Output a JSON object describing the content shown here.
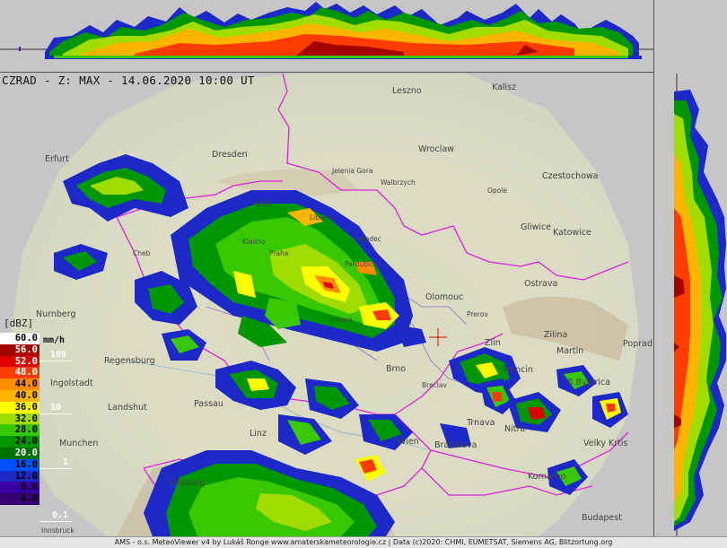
{
  "header": {
    "title": "CZRAD - Z: MAX - 14.06.2020 10:00 UT"
  },
  "footer": {
    "credits": "AMS - o.s. MeteoViewer v4 by Lukáš Ronge www.amaterskameteorologie.cz | Data (c)2020: CHMI, EUMETSAT, Siemens AG, Blitzortung.org"
  },
  "legend": {
    "title": "[dBZ]",
    "unit": "mm/h",
    "levels": [
      {
        "label": "60.0",
        "color": "#ffffff",
        "text": "#000000"
      },
      {
        "label": "56.0",
        "color": "#a40000",
        "text": "#ffffff"
      },
      {
        "label": "52.0",
        "color": "#dc0000",
        "text": "#ffffff"
      },
      {
        "label": "48.0",
        "color": "#ff3c00",
        "text": "#ffffff"
      },
      {
        "label": "44.0",
        "color": "#ff8c00",
        "text": "#000000"
      },
      {
        "label": "40.0",
        "color": "#ffb400",
        "text": "#000000"
      },
      {
        "label": "36.0",
        "color": "#ffff00",
        "text": "#000000"
      },
      {
        "label": "32.0",
        "color": "#a0dc00",
        "text": "#000000"
      },
      {
        "label": "28.0",
        "color": "#38c800",
        "text": "#000000"
      },
      {
        "label": "24.0",
        "color": "#009600",
        "text": "#000000"
      },
      {
        "label": "20.0",
        "color": "#007000",
        "text": "#ffffff"
      },
      {
        "label": "16.0",
        "color": "#0050ff",
        "text": "#000000"
      },
      {
        "label": "12.0",
        "color": "#1c28c8",
        "text": "#000000"
      },
      {
        "label": "8.0",
        "color": "#3800a0",
        "text": "#000000"
      },
      {
        "label": "4.0",
        "color": "#380070",
        "text": "#000000"
      }
    ],
    "rates": [
      "100",
      "10",
      "1",
      "0.1"
    ]
  },
  "cities": [
    {
      "name": "Leszno"
    },
    {
      "name": "Kalisz"
    },
    {
      "name": "Wroclaw"
    },
    {
      "name": "Dresden"
    },
    {
      "name": "Jelenia Gora"
    },
    {
      "name": "Walbrzych"
    },
    {
      "name": "Opole"
    },
    {
      "name": "Czestochowa"
    },
    {
      "name": "Gliwice"
    },
    {
      "name": "Katowice"
    },
    {
      "name": "Erfurt"
    },
    {
      "name": "Ústí"
    },
    {
      "name": "Cheb"
    },
    {
      "name": "Praha"
    },
    {
      "name": "Kladno"
    },
    {
      "name": "Liberec"
    },
    {
      "name": "Hradec"
    },
    {
      "name": "Pardubice"
    },
    {
      "name": "Jihlava"
    },
    {
      "name": "Olomouc"
    },
    {
      "name": "Prerov"
    },
    {
      "name": "Ostrava"
    },
    {
      "name": "Zilina"
    },
    {
      "name": "Martin"
    },
    {
      "name": "Poprad"
    },
    {
      "name": "Zlin"
    },
    {
      "name": "Trencin"
    },
    {
      "name": "B.Bystrica"
    },
    {
      "name": "Nurnberg"
    },
    {
      "name": "Regensburg"
    },
    {
      "name": "Ingolstadt"
    },
    {
      "name": "Landshut"
    },
    {
      "name": "Passau"
    },
    {
      "name": "Linz"
    },
    {
      "name": "Munchen"
    },
    {
      "name": "Salzburg"
    },
    {
      "name": "Innsbruck"
    },
    {
      "name": "Wien"
    },
    {
      "name": "Bratislava"
    },
    {
      "name": "Trnava"
    },
    {
      "name": "Nitra"
    },
    {
      "name": "Velky Krtis"
    },
    {
      "name": "Komarno"
    },
    {
      "name": "Budapest"
    },
    {
      "name": "Brno"
    },
    {
      "name": "Breclav"
    }
  ]
}
